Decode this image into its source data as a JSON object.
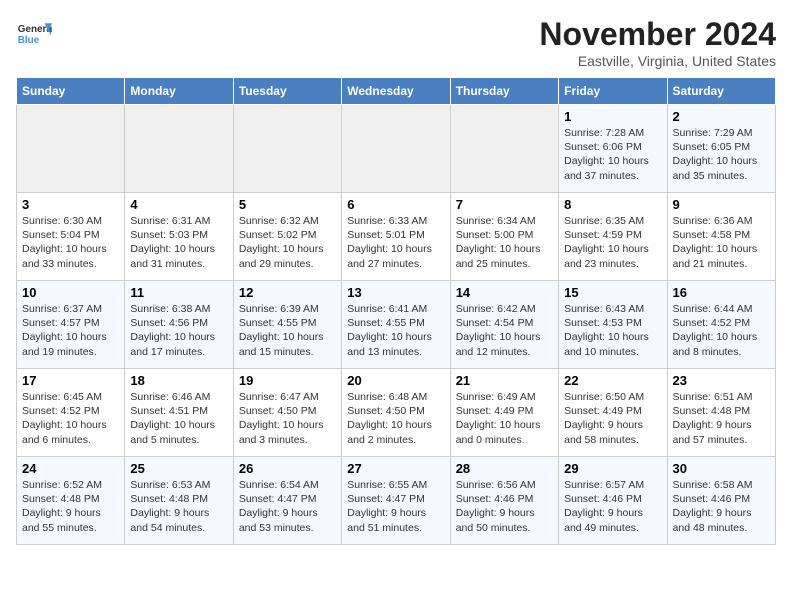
{
  "header": {
    "logo_general": "General",
    "logo_blue": "Blue",
    "month": "November 2024",
    "location": "Eastville, Virginia, United States"
  },
  "days_of_week": [
    "Sunday",
    "Monday",
    "Tuesday",
    "Wednesday",
    "Thursday",
    "Friday",
    "Saturday"
  ],
  "weeks": [
    [
      {
        "day": "",
        "detail": ""
      },
      {
        "day": "",
        "detail": ""
      },
      {
        "day": "",
        "detail": ""
      },
      {
        "day": "",
        "detail": ""
      },
      {
        "day": "",
        "detail": ""
      },
      {
        "day": "1",
        "detail": "Sunrise: 7:28 AM\nSunset: 6:06 PM\nDaylight: 10 hours\nand 37 minutes."
      },
      {
        "day": "2",
        "detail": "Sunrise: 7:29 AM\nSunset: 6:05 PM\nDaylight: 10 hours\nand 35 minutes."
      }
    ],
    [
      {
        "day": "3",
        "detail": "Sunrise: 6:30 AM\nSunset: 5:04 PM\nDaylight: 10 hours\nand 33 minutes."
      },
      {
        "day": "4",
        "detail": "Sunrise: 6:31 AM\nSunset: 5:03 PM\nDaylight: 10 hours\nand 31 minutes."
      },
      {
        "day": "5",
        "detail": "Sunrise: 6:32 AM\nSunset: 5:02 PM\nDaylight: 10 hours\nand 29 minutes."
      },
      {
        "day": "6",
        "detail": "Sunrise: 6:33 AM\nSunset: 5:01 PM\nDaylight: 10 hours\nand 27 minutes."
      },
      {
        "day": "7",
        "detail": "Sunrise: 6:34 AM\nSunset: 5:00 PM\nDaylight: 10 hours\nand 25 minutes."
      },
      {
        "day": "8",
        "detail": "Sunrise: 6:35 AM\nSunset: 4:59 PM\nDaylight: 10 hours\nand 23 minutes."
      },
      {
        "day": "9",
        "detail": "Sunrise: 6:36 AM\nSunset: 4:58 PM\nDaylight: 10 hours\nand 21 minutes."
      }
    ],
    [
      {
        "day": "10",
        "detail": "Sunrise: 6:37 AM\nSunset: 4:57 PM\nDaylight: 10 hours\nand 19 minutes."
      },
      {
        "day": "11",
        "detail": "Sunrise: 6:38 AM\nSunset: 4:56 PM\nDaylight: 10 hours\nand 17 minutes."
      },
      {
        "day": "12",
        "detail": "Sunrise: 6:39 AM\nSunset: 4:55 PM\nDaylight: 10 hours\nand 15 minutes."
      },
      {
        "day": "13",
        "detail": "Sunrise: 6:41 AM\nSunset: 4:55 PM\nDaylight: 10 hours\nand 13 minutes."
      },
      {
        "day": "14",
        "detail": "Sunrise: 6:42 AM\nSunset: 4:54 PM\nDaylight: 10 hours\nand 12 minutes."
      },
      {
        "day": "15",
        "detail": "Sunrise: 6:43 AM\nSunset: 4:53 PM\nDaylight: 10 hours\nand 10 minutes."
      },
      {
        "day": "16",
        "detail": "Sunrise: 6:44 AM\nSunset: 4:52 PM\nDaylight: 10 hours\nand 8 minutes."
      }
    ],
    [
      {
        "day": "17",
        "detail": "Sunrise: 6:45 AM\nSunset: 4:52 PM\nDaylight: 10 hours\nand 6 minutes."
      },
      {
        "day": "18",
        "detail": "Sunrise: 6:46 AM\nSunset: 4:51 PM\nDaylight: 10 hours\nand 5 minutes."
      },
      {
        "day": "19",
        "detail": "Sunrise: 6:47 AM\nSunset: 4:50 PM\nDaylight: 10 hours\nand 3 minutes."
      },
      {
        "day": "20",
        "detail": "Sunrise: 6:48 AM\nSunset: 4:50 PM\nDaylight: 10 hours\nand 2 minutes."
      },
      {
        "day": "21",
        "detail": "Sunrise: 6:49 AM\nSunset: 4:49 PM\nDaylight: 10 hours\nand 0 minutes."
      },
      {
        "day": "22",
        "detail": "Sunrise: 6:50 AM\nSunset: 4:49 PM\nDaylight: 9 hours\nand 58 minutes."
      },
      {
        "day": "23",
        "detail": "Sunrise: 6:51 AM\nSunset: 4:48 PM\nDaylight: 9 hours\nand 57 minutes."
      }
    ],
    [
      {
        "day": "24",
        "detail": "Sunrise: 6:52 AM\nSunset: 4:48 PM\nDaylight: 9 hours\nand 55 minutes."
      },
      {
        "day": "25",
        "detail": "Sunrise: 6:53 AM\nSunset: 4:48 PM\nDaylight: 9 hours\nand 54 minutes."
      },
      {
        "day": "26",
        "detail": "Sunrise: 6:54 AM\nSunset: 4:47 PM\nDaylight: 9 hours\nand 53 minutes."
      },
      {
        "day": "27",
        "detail": "Sunrise: 6:55 AM\nSunset: 4:47 PM\nDaylight: 9 hours\nand 51 minutes."
      },
      {
        "day": "28",
        "detail": "Sunrise: 6:56 AM\nSunset: 4:46 PM\nDaylight: 9 hours\nand 50 minutes."
      },
      {
        "day": "29",
        "detail": "Sunrise: 6:57 AM\nSunset: 4:46 PM\nDaylight: 9 hours\nand 49 minutes."
      },
      {
        "day": "30",
        "detail": "Sunrise: 6:58 AM\nSunset: 4:46 PM\nDaylight: 9 hours\nand 48 minutes."
      }
    ]
  ]
}
